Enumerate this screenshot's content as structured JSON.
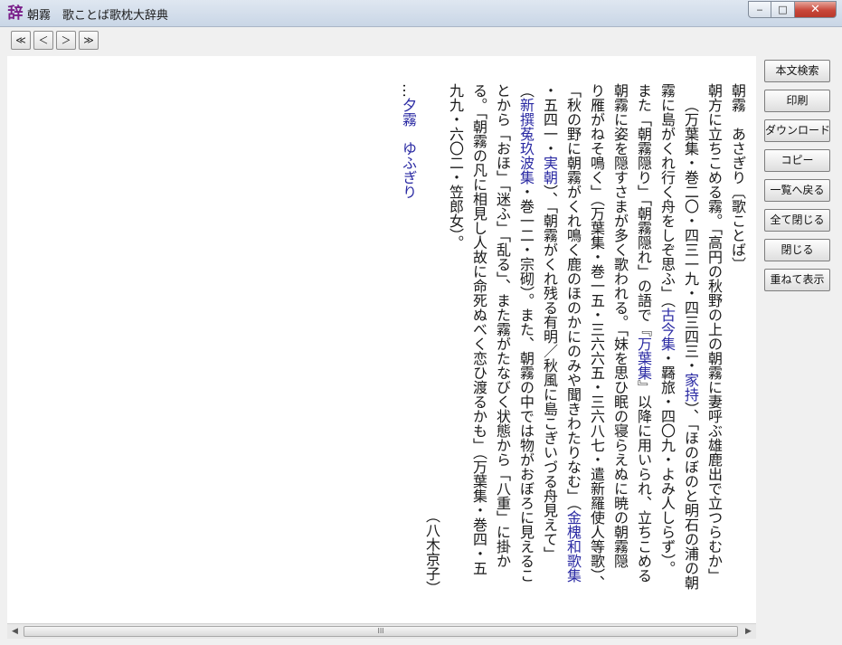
{
  "window": {
    "icon_char": "辞",
    "title": "朝霧　歌ことば歌枕大辞典",
    "minimize": "‒",
    "maximize": "□",
    "close": "✕"
  },
  "nav": {
    "first": "≪",
    "prev": "＜",
    "next": "＞",
    "last": "≫"
  },
  "side_buttons": [
    "本文検索",
    "印刷",
    "ダウンロード",
    "コピー",
    "一覧へ戻る",
    "全て閉じる",
    "閉じる",
    "重ねて表示"
  ],
  "entry": {
    "line1": "朝霧　あさぎり〔歌ことば〕",
    "line2": "朝方に立ちこめる霧。「高円の秋野の上の朝霧に妻呼ぶ雄鹿出で立つらむか」",
    "line3a": "（万葉集・巻二〇・四三一九・四三四三・",
    "line3_link1": "家持",
    "line3b": "）、「ほのぼのと明石の浦の朝",
    "line4a": "霧に島がくれ行く舟をしぞ思ふ」（",
    "line4_link1": "古今集",
    "line4b": "・羇旅・四〇九・よみ人しらず）。",
    "line5a": "また「朝霧隠り」「朝霧隠れ」の語で『",
    "line5_link1": "万葉集",
    "line5b": "』以降に用いられ、立ちこめる",
    "line6": "朝霧に姿を隠すさまが多く歌われる。「妹を思ひ眠の寝らえぬに暁の朝霧隠",
    "line7": "り雁がねそ鳴く」（万葉集・巻一五・三六六五・三六八七・遣新羅使人等歌）、",
    "line8a": "「秋の野に朝霧がくれ鳴く鹿のほのかにのみや聞きわたりなむ」（",
    "line8_link1": "金槐和歌集",
    "line9a": "・五四一・",
    "line9_link1": "実朝",
    "line9b": "）、「朝霧がくれ残る有明／秋風に島こぎいづる舟見えて」",
    "line10a": "（",
    "line10_link1": "新撰菟玖波集",
    "line10b": "・巻一二・宗砌）。また、朝霧の中では物がおぼろに見えるこ",
    "line11": "とから「おほ」「迷ふ」「乱る」、また霧がたなびく状態から「八重」に掛か",
    "line12": "る。「朝霧の凡に相見し人故に命死ぬべく恋ひ渡るかも」（万葉集・巻四・五",
    "line13": "九九・六〇二・笠郎女）。",
    "signature": "（八木京子）",
    "see_also_prefix": "…",
    "see_also_link": "夕霧　ゆふぎり"
  },
  "scrollbar": {
    "left_arrow": "◀",
    "right_arrow": "▶",
    "grip": "III"
  }
}
